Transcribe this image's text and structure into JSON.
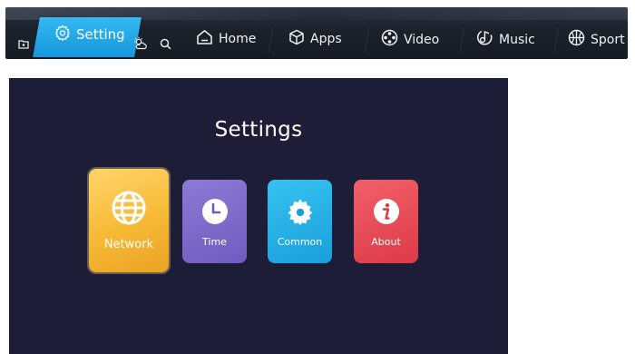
{
  "topbar": {
    "active_tab": {
      "label": "Setting",
      "icon": "gear-icon"
    },
    "small_icons": [
      "folder-icon",
      "weather-icon",
      "search-icon"
    ],
    "nav_items": [
      {
        "label": "Home",
        "icon": "home-icon"
      },
      {
        "label": "Apps",
        "icon": "apps-cube-icon"
      },
      {
        "label": "Video",
        "icon": "video-reel-icon"
      },
      {
        "label": "Music",
        "icon": "music-note-icon"
      },
      {
        "label": "Sport",
        "icon": "sport-ball-icon"
      }
    ],
    "colors": {
      "bar_bg": "#161c25",
      "active_tab": "#1597db"
    }
  },
  "settings": {
    "title": "Settings",
    "tiles": [
      {
        "label": "Network",
        "icon": "globe-icon",
        "color": "#f6b936",
        "focused": true
      },
      {
        "label": "Time",
        "icon": "clock-icon",
        "color": "#6f5cbf",
        "focused": false
      },
      {
        "label": "Common",
        "icon": "gear-icon",
        "color": "#1a9fdb",
        "focused": false
      },
      {
        "label": "About",
        "icon": "info-icon",
        "color": "#dc3a47",
        "focused": false
      }
    ],
    "colors": {
      "panel_bg": "#1d1d38"
    }
  }
}
